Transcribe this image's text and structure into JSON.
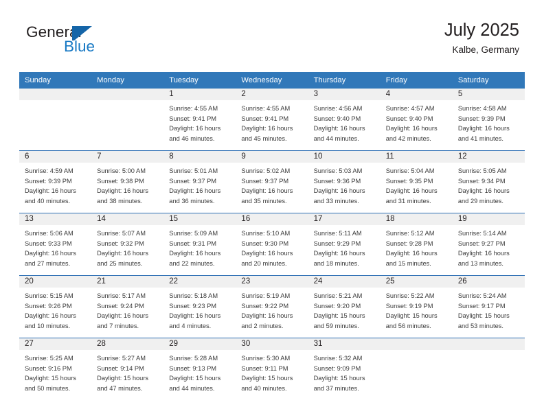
{
  "brand": {
    "name_primary": "General",
    "name_secondary": "Blue",
    "flag_color": "#1565a8",
    "text_color": "#1879c4"
  },
  "header": {
    "title": "July 2025",
    "subtitle": "Kalbe, Germany",
    "header_bg": "#3178b9",
    "daynum_bg": "#f0f0f0",
    "week_divider": "#2a6db3"
  },
  "weekday_headers": [
    "Sunday",
    "Monday",
    "Tuesday",
    "Wednesday",
    "Thursday",
    "Friday",
    "Saturday"
  ],
  "weeks": [
    [
      {
        "day": "",
        "sunrise": "",
        "sunset": "",
        "daylight1": "",
        "daylight2": ""
      },
      {
        "day": "",
        "sunrise": "",
        "sunset": "",
        "daylight1": "",
        "daylight2": ""
      },
      {
        "day": "1",
        "sunrise": "Sunrise: 4:55 AM",
        "sunset": "Sunset: 9:41 PM",
        "daylight1": "Daylight: 16 hours",
        "daylight2": "and 46 minutes."
      },
      {
        "day": "2",
        "sunrise": "Sunrise: 4:55 AM",
        "sunset": "Sunset: 9:41 PM",
        "daylight1": "Daylight: 16 hours",
        "daylight2": "and 45 minutes."
      },
      {
        "day": "3",
        "sunrise": "Sunrise: 4:56 AM",
        "sunset": "Sunset: 9:40 PM",
        "daylight1": "Daylight: 16 hours",
        "daylight2": "and 44 minutes."
      },
      {
        "day": "4",
        "sunrise": "Sunrise: 4:57 AM",
        "sunset": "Sunset: 9:40 PM",
        "daylight1": "Daylight: 16 hours",
        "daylight2": "and 42 minutes."
      },
      {
        "day": "5",
        "sunrise": "Sunrise: 4:58 AM",
        "sunset": "Sunset: 9:39 PM",
        "daylight1": "Daylight: 16 hours",
        "daylight2": "and 41 minutes."
      }
    ],
    [
      {
        "day": "6",
        "sunrise": "Sunrise: 4:59 AM",
        "sunset": "Sunset: 9:39 PM",
        "daylight1": "Daylight: 16 hours",
        "daylight2": "and 40 minutes."
      },
      {
        "day": "7",
        "sunrise": "Sunrise: 5:00 AM",
        "sunset": "Sunset: 9:38 PM",
        "daylight1": "Daylight: 16 hours",
        "daylight2": "and 38 minutes."
      },
      {
        "day": "8",
        "sunrise": "Sunrise: 5:01 AM",
        "sunset": "Sunset: 9:37 PM",
        "daylight1": "Daylight: 16 hours",
        "daylight2": "and 36 minutes."
      },
      {
        "day": "9",
        "sunrise": "Sunrise: 5:02 AM",
        "sunset": "Sunset: 9:37 PM",
        "daylight1": "Daylight: 16 hours",
        "daylight2": "and 35 minutes."
      },
      {
        "day": "10",
        "sunrise": "Sunrise: 5:03 AM",
        "sunset": "Sunset: 9:36 PM",
        "daylight1": "Daylight: 16 hours",
        "daylight2": "and 33 minutes."
      },
      {
        "day": "11",
        "sunrise": "Sunrise: 5:04 AM",
        "sunset": "Sunset: 9:35 PM",
        "daylight1": "Daylight: 16 hours",
        "daylight2": "and 31 minutes."
      },
      {
        "day": "12",
        "sunrise": "Sunrise: 5:05 AM",
        "sunset": "Sunset: 9:34 PM",
        "daylight1": "Daylight: 16 hours",
        "daylight2": "and 29 minutes."
      }
    ],
    [
      {
        "day": "13",
        "sunrise": "Sunrise: 5:06 AM",
        "sunset": "Sunset: 9:33 PM",
        "daylight1": "Daylight: 16 hours",
        "daylight2": "and 27 minutes."
      },
      {
        "day": "14",
        "sunrise": "Sunrise: 5:07 AM",
        "sunset": "Sunset: 9:32 PM",
        "daylight1": "Daylight: 16 hours",
        "daylight2": "and 25 minutes."
      },
      {
        "day": "15",
        "sunrise": "Sunrise: 5:09 AM",
        "sunset": "Sunset: 9:31 PM",
        "daylight1": "Daylight: 16 hours",
        "daylight2": "and 22 minutes."
      },
      {
        "day": "16",
        "sunrise": "Sunrise: 5:10 AM",
        "sunset": "Sunset: 9:30 PM",
        "daylight1": "Daylight: 16 hours",
        "daylight2": "and 20 minutes."
      },
      {
        "day": "17",
        "sunrise": "Sunrise: 5:11 AM",
        "sunset": "Sunset: 9:29 PM",
        "daylight1": "Daylight: 16 hours",
        "daylight2": "and 18 minutes."
      },
      {
        "day": "18",
        "sunrise": "Sunrise: 5:12 AM",
        "sunset": "Sunset: 9:28 PM",
        "daylight1": "Daylight: 16 hours",
        "daylight2": "and 15 minutes."
      },
      {
        "day": "19",
        "sunrise": "Sunrise: 5:14 AM",
        "sunset": "Sunset: 9:27 PM",
        "daylight1": "Daylight: 16 hours",
        "daylight2": "and 13 minutes."
      }
    ],
    [
      {
        "day": "20",
        "sunrise": "Sunrise: 5:15 AM",
        "sunset": "Sunset: 9:26 PM",
        "daylight1": "Daylight: 16 hours",
        "daylight2": "and 10 minutes."
      },
      {
        "day": "21",
        "sunrise": "Sunrise: 5:17 AM",
        "sunset": "Sunset: 9:24 PM",
        "daylight1": "Daylight: 16 hours",
        "daylight2": "and 7 minutes."
      },
      {
        "day": "22",
        "sunrise": "Sunrise: 5:18 AM",
        "sunset": "Sunset: 9:23 PM",
        "daylight1": "Daylight: 16 hours",
        "daylight2": "and 4 minutes."
      },
      {
        "day": "23",
        "sunrise": "Sunrise: 5:19 AM",
        "sunset": "Sunset: 9:22 PM",
        "daylight1": "Daylight: 16 hours",
        "daylight2": "and 2 minutes."
      },
      {
        "day": "24",
        "sunrise": "Sunrise: 5:21 AM",
        "sunset": "Sunset: 9:20 PM",
        "daylight1": "Daylight: 15 hours",
        "daylight2": "and 59 minutes."
      },
      {
        "day": "25",
        "sunrise": "Sunrise: 5:22 AM",
        "sunset": "Sunset: 9:19 PM",
        "daylight1": "Daylight: 15 hours",
        "daylight2": "and 56 minutes."
      },
      {
        "day": "26",
        "sunrise": "Sunrise: 5:24 AM",
        "sunset": "Sunset: 9:17 PM",
        "daylight1": "Daylight: 15 hours",
        "daylight2": "and 53 minutes."
      }
    ],
    [
      {
        "day": "27",
        "sunrise": "Sunrise: 5:25 AM",
        "sunset": "Sunset: 9:16 PM",
        "daylight1": "Daylight: 15 hours",
        "daylight2": "and 50 minutes."
      },
      {
        "day": "28",
        "sunrise": "Sunrise: 5:27 AM",
        "sunset": "Sunset: 9:14 PM",
        "daylight1": "Daylight: 15 hours",
        "daylight2": "and 47 minutes."
      },
      {
        "day": "29",
        "sunrise": "Sunrise: 5:28 AM",
        "sunset": "Sunset: 9:13 PM",
        "daylight1": "Daylight: 15 hours",
        "daylight2": "and 44 minutes."
      },
      {
        "day": "30",
        "sunrise": "Sunrise: 5:30 AM",
        "sunset": "Sunset: 9:11 PM",
        "daylight1": "Daylight: 15 hours",
        "daylight2": "and 40 minutes."
      },
      {
        "day": "31",
        "sunrise": "Sunrise: 5:32 AM",
        "sunset": "Sunset: 9:09 PM",
        "daylight1": "Daylight: 15 hours",
        "daylight2": "and 37 minutes."
      },
      {
        "day": "",
        "sunrise": "",
        "sunset": "",
        "daylight1": "",
        "daylight2": ""
      },
      {
        "day": "",
        "sunrise": "",
        "sunset": "",
        "daylight1": "",
        "daylight2": ""
      }
    ]
  ]
}
